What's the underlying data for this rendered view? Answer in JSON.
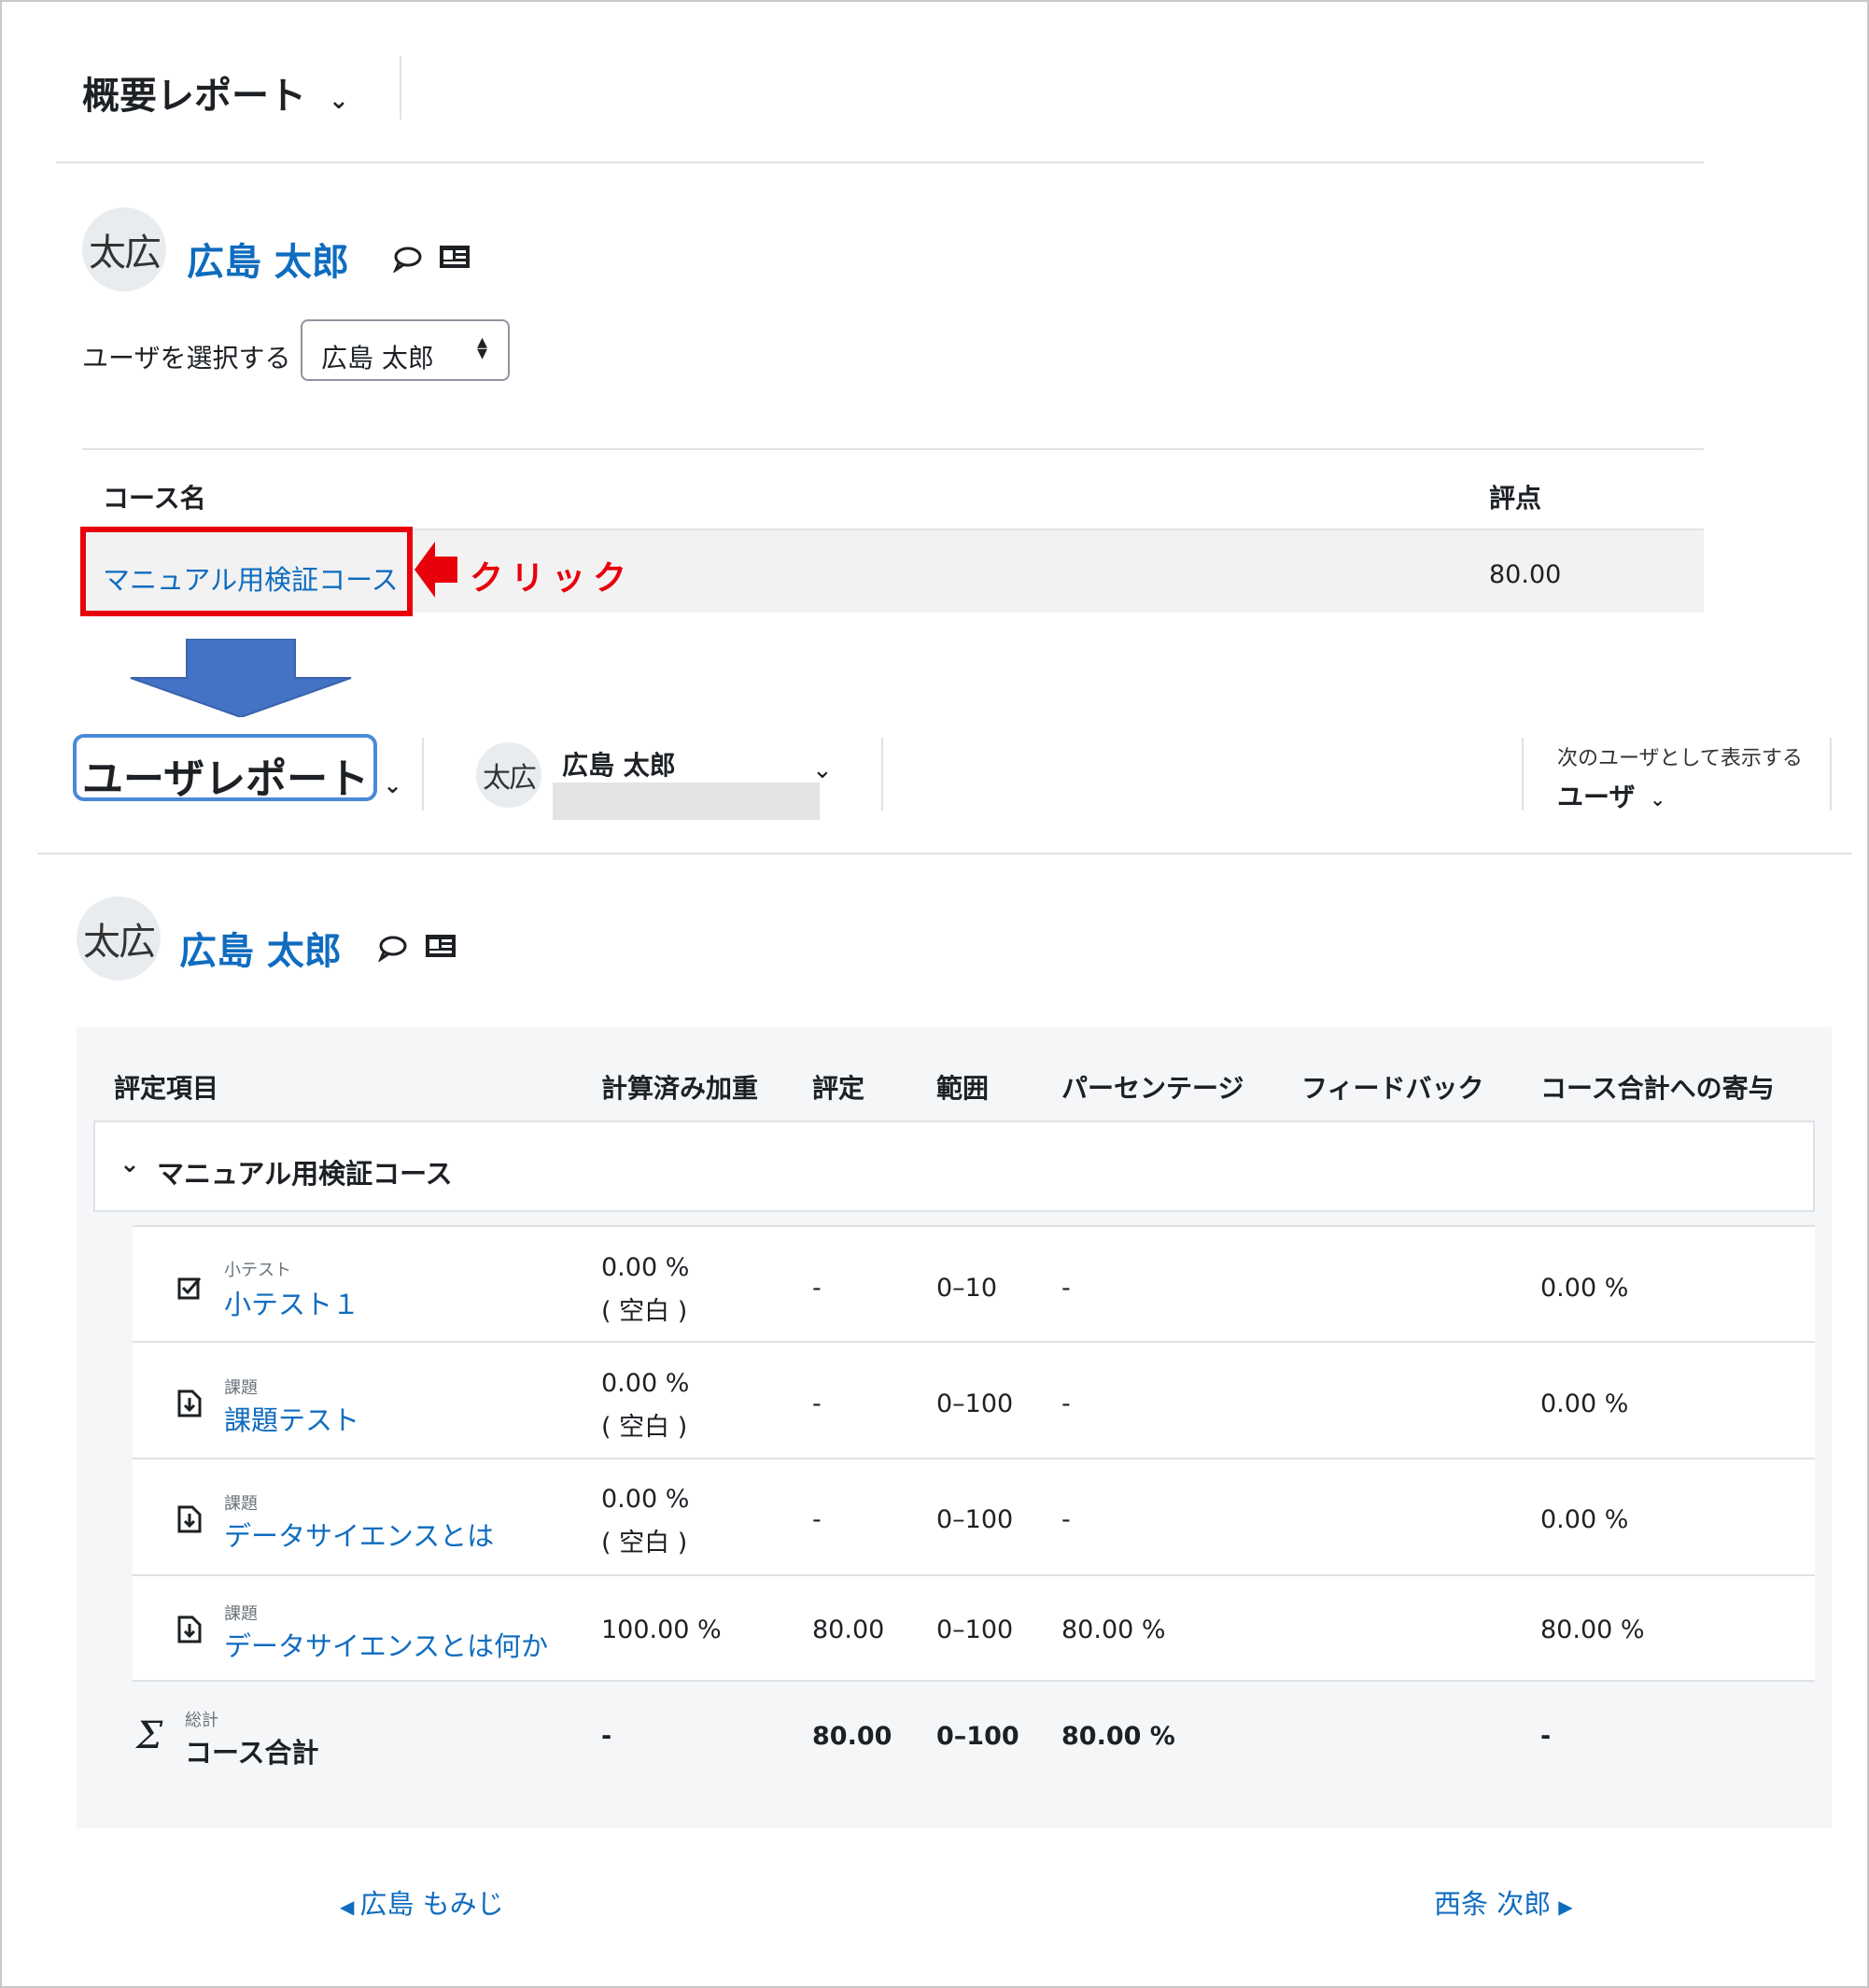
{
  "overview": {
    "title": "概要レポート",
    "user_initials": "太広",
    "user_name": "広島 太郎",
    "select_label": "ユーザを選択する",
    "select_value": "広島 太郎",
    "col_course": "コース名",
    "col_grade": "評点",
    "course_name": "マニュアル用検証コース",
    "course_grade": "80.00",
    "click_annotation": "クリック",
    "annotation_color": "#e8000b",
    "arrow_color": "#4472c4"
  },
  "user_report": {
    "title": "ユーザレポート",
    "user_initials": "太広",
    "user_name": "広島 太郎",
    "view_as_label": "次のユーザとして表示する",
    "view_as_value": "ユーザ",
    "heading_initials": "太広",
    "heading_name": "広島 太郎",
    "columns": [
      "評定項目",
      "計算済み加重",
      "評定",
      "範囲",
      "パーセンテージ",
      "フィードバック",
      "コース合計への寄与"
    ],
    "category": "マニュアル用検証コース",
    "items": [
      {
        "type": "小テスト",
        "name": "小テスト１",
        "icon": "quiz-icon",
        "weight": "0.00 %",
        "weight_note": "( 空白 )",
        "grade": "-",
        "range": "0–10",
        "percentage": "-",
        "feedback": "",
        "contribution": "0.00 %"
      },
      {
        "type": "課題",
        "name": "課題テスト",
        "icon": "assignment-icon",
        "weight": "0.00 %",
        "weight_note": "( 空白 )",
        "grade": "-",
        "range": "0–100",
        "percentage": "-",
        "feedback": "",
        "contribution": "0.00 %"
      },
      {
        "type": "課題",
        "name": "データサイエンスとは",
        "icon": "assignment-icon",
        "weight": "0.00 %",
        "weight_note": "( 空白 )",
        "grade": "-",
        "range": "0–100",
        "percentage": "-",
        "feedback": "",
        "contribution": "0.00 %"
      },
      {
        "type": "課題",
        "name": "データサイエンスとは何か",
        "icon": "assignment-icon",
        "weight": "100.00 %",
        "weight_note": "",
        "grade": "80.00",
        "range": "0–100",
        "percentage": "80.00 %",
        "feedback": "",
        "contribution": "80.00 %"
      }
    ],
    "total": {
      "type": "総計",
      "name": "コース合計",
      "weight": "-",
      "grade": "80.00",
      "range": "0–100",
      "percentage": "80.00 %",
      "contribution": "-"
    },
    "prev_user": "広島 もみじ",
    "next_user": "西条 次郎"
  }
}
